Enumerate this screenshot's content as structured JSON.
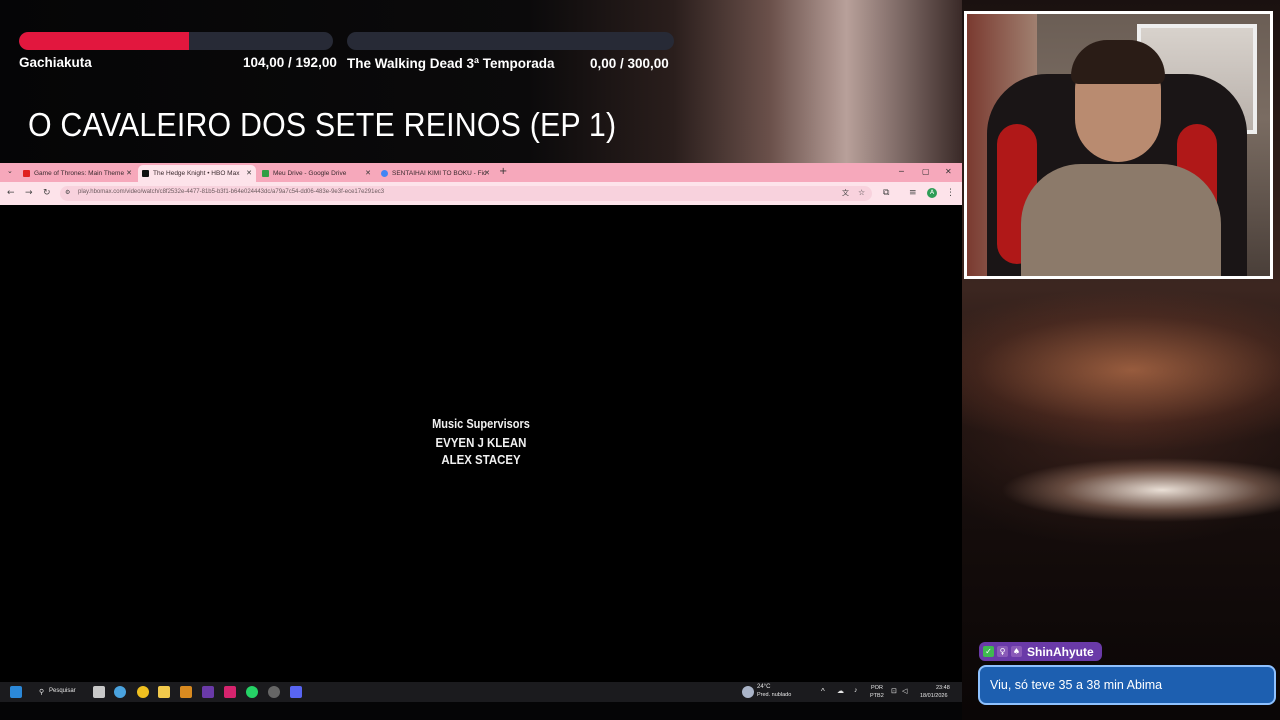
{
  "goals": [
    {
      "name": "Gachiakuta",
      "value_text": "104,00 / 192,00",
      "current": 104,
      "target": 192
    },
    {
      "name": "The Walking Dead 3ª Temporada",
      "value_text": "0,00 / 300,00",
      "current": 0,
      "target": 300
    }
  ],
  "episode_title": "O CAVALEIRO DOS SETE REINOS (EP 1)",
  "browser": {
    "tabs": [
      {
        "label": "Game of Thrones: Main Theme",
        "favicon": "youtube-icon",
        "active": false
      },
      {
        "label": "The Hedge Knight • HBO Max",
        "favicon": "hbomax-icon",
        "active": true
      },
      {
        "label": "Meu Drive - Google Drive",
        "favicon": "drive-icon",
        "active": false
      },
      {
        "label": "SENTAIHAI KIMI TO BOKU - Fic",
        "favicon": "google-icon",
        "active": false
      }
    ],
    "new_tab": "+",
    "url": "play.hbomax.com/video/watch/c8f2532e-4477-81b5-b3f1-b64e024443dc/a79a7c54-dd06-483e-9e3f-ece17e291ec3"
  },
  "credits": {
    "role": "Music Supervisors",
    "names": [
      "EVYEN J KLEAN",
      "ALEX STACEY"
    ]
  },
  "taskbar": {
    "search_label": "Pesquisar",
    "weather_temp": "24°C",
    "weather_desc": "Pred. nublado",
    "lang_top": "POR",
    "lang_bottom": "PTB2",
    "time": "23:48",
    "date": "18/01/2026"
  },
  "chat": {
    "username": "ShinAhyute",
    "message": "Viu, só teve 35 a 38 min Abima"
  },
  "colors": {
    "goal_fill": "#e2173e",
    "goal_track": "#272a36",
    "tabstrip": "#f6a8bb",
    "chat_name_bg": "#6a3aa8",
    "chat_msg_bg": "#1d5fb0"
  }
}
